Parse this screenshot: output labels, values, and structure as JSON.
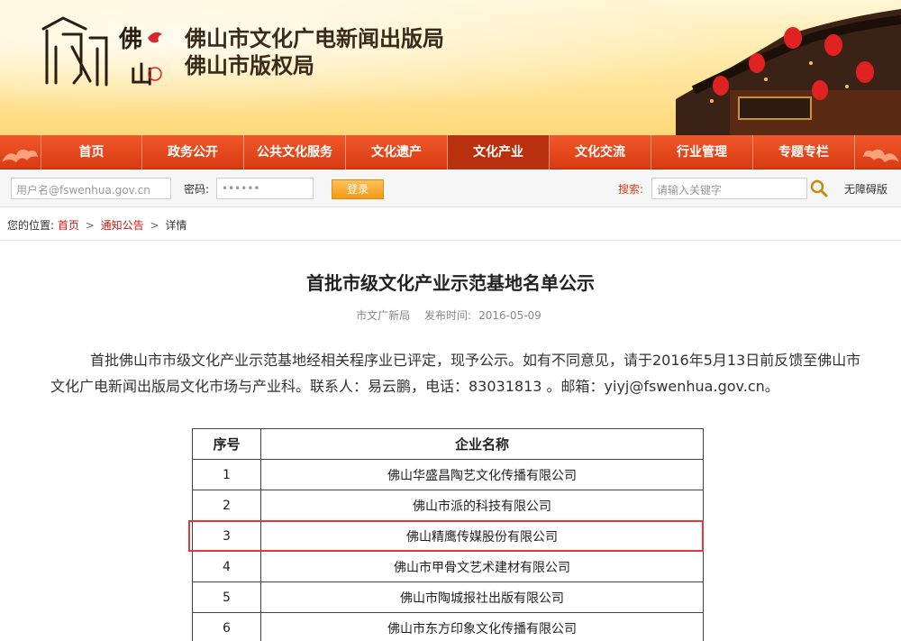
{
  "header": {
    "title_line1": "佛山市文化广电新闻出版局",
    "title_line2": "佛山市版权局",
    "logo_label": "佛山",
    "brand_color": "#d93a12"
  },
  "nav": {
    "items": [
      {
        "label": "首页"
      },
      {
        "label": "政务公开"
      },
      {
        "label": "公共文化服务"
      },
      {
        "label": "文化遗产"
      },
      {
        "label": "文化产业",
        "active": true
      },
      {
        "label": "文化交流"
      },
      {
        "label": "行业管理"
      },
      {
        "label": "专题专栏"
      }
    ]
  },
  "login": {
    "username_placeholder": "用户名@fswenhua.gov.cn",
    "password_label": "密码:",
    "password_value": "••••••",
    "login_button": "登录"
  },
  "search": {
    "label": "搜索:",
    "placeholder": "请输入关键字",
    "accessible_link": "无障碍版"
  },
  "breadcrumb": {
    "prefix": "您的位置:",
    "home": "首页",
    "section": "通知公告",
    "current": "详情",
    "separator": ">"
  },
  "article": {
    "title": "首批市级文化产业示范基地名单公示",
    "source": "市文广新局",
    "date_label": "发布时间:",
    "date": "2016-05-09",
    "body": "首批佛山市市级文化产业示范基地经相关程序业已评定，现予公示。如有不同意见，请于2016年5月13日前反馈至佛山市文化广电新闻出版局文化市场与产业科。联系人：易云鹏，电话：83031813 。邮箱：yiyj@fswenhua.gov.cn。"
  },
  "table": {
    "headers": [
      "序号",
      "企业名称"
    ],
    "rows": [
      [
        "1",
        "佛山华盛昌陶艺文化传播有限公司"
      ],
      [
        "2",
        "佛山市派的科技有限公司"
      ],
      [
        "3",
        "佛山精鹰传媒股份有限公司"
      ],
      [
        "4",
        "佛山市甲骨文艺术建材有限公司"
      ],
      [
        "5",
        "佛山市陶城报社出版有限公司"
      ],
      [
        "6",
        "佛山市东方印象文化传播有限公司"
      ]
    ],
    "highlighted_row": 3
  }
}
